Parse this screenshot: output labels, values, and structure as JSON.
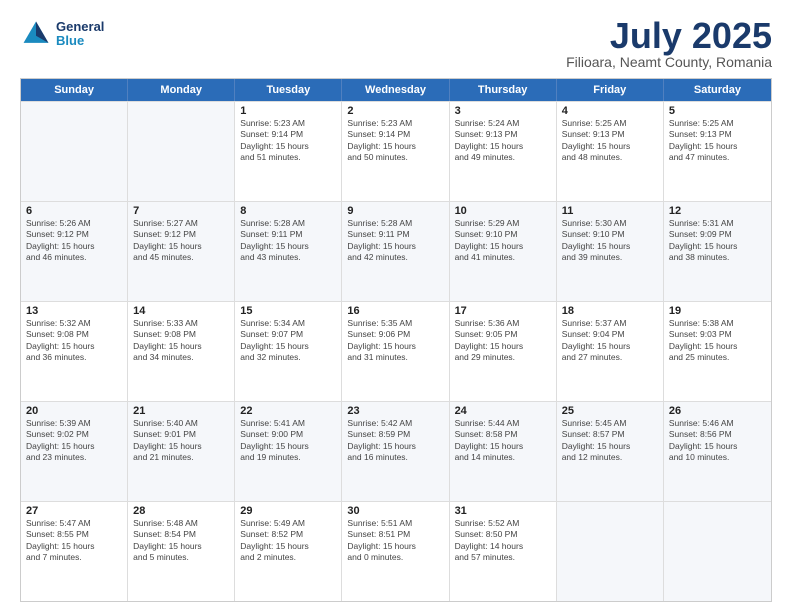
{
  "header": {
    "logo_line1": "General",
    "logo_line2": "Blue",
    "title": "July 2025",
    "subtitle": "Filioara, Neamt County, Romania"
  },
  "days_of_week": [
    "Sunday",
    "Monday",
    "Tuesday",
    "Wednesday",
    "Thursday",
    "Friday",
    "Saturday"
  ],
  "weeks": [
    [
      {
        "day": "",
        "info": ""
      },
      {
        "day": "",
        "info": ""
      },
      {
        "day": "1",
        "info": "Sunrise: 5:23 AM\nSunset: 9:14 PM\nDaylight: 15 hours\nand 51 minutes."
      },
      {
        "day": "2",
        "info": "Sunrise: 5:23 AM\nSunset: 9:14 PM\nDaylight: 15 hours\nand 50 minutes."
      },
      {
        "day": "3",
        "info": "Sunrise: 5:24 AM\nSunset: 9:13 PM\nDaylight: 15 hours\nand 49 minutes."
      },
      {
        "day": "4",
        "info": "Sunrise: 5:25 AM\nSunset: 9:13 PM\nDaylight: 15 hours\nand 48 minutes."
      },
      {
        "day": "5",
        "info": "Sunrise: 5:25 AM\nSunset: 9:13 PM\nDaylight: 15 hours\nand 47 minutes."
      }
    ],
    [
      {
        "day": "6",
        "info": "Sunrise: 5:26 AM\nSunset: 9:12 PM\nDaylight: 15 hours\nand 46 minutes."
      },
      {
        "day": "7",
        "info": "Sunrise: 5:27 AM\nSunset: 9:12 PM\nDaylight: 15 hours\nand 45 minutes."
      },
      {
        "day": "8",
        "info": "Sunrise: 5:28 AM\nSunset: 9:11 PM\nDaylight: 15 hours\nand 43 minutes."
      },
      {
        "day": "9",
        "info": "Sunrise: 5:28 AM\nSunset: 9:11 PM\nDaylight: 15 hours\nand 42 minutes."
      },
      {
        "day": "10",
        "info": "Sunrise: 5:29 AM\nSunset: 9:10 PM\nDaylight: 15 hours\nand 41 minutes."
      },
      {
        "day": "11",
        "info": "Sunrise: 5:30 AM\nSunset: 9:10 PM\nDaylight: 15 hours\nand 39 minutes."
      },
      {
        "day": "12",
        "info": "Sunrise: 5:31 AM\nSunset: 9:09 PM\nDaylight: 15 hours\nand 38 minutes."
      }
    ],
    [
      {
        "day": "13",
        "info": "Sunrise: 5:32 AM\nSunset: 9:08 PM\nDaylight: 15 hours\nand 36 minutes."
      },
      {
        "day": "14",
        "info": "Sunrise: 5:33 AM\nSunset: 9:08 PM\nDaylight: 15 hours\nand 34 minutes."
      },
      {
        "day": "15",
        "info": "Sunrise: 5:34 AM\nSunset: 9:07 PM\nDaylight: 15 hours\nand 32 minutes."
      },
      {
        "day": "16",
        "info": "Sunrise: 5:35 AM\nSunset: 9:06 PM\nDaylight: 15 hours\nand 31 minutes."
      },
      {
        "day": "17",
        "info": "Sunrise: 5:36 AM\nSunset: 9:05 PM\nDaylight: 15 hours\nand 29 minutes."
      },
      {
        "day": "18",
        "info": "Sunrise: 5:37 AM\nSunset: 9:04 PM\nDaylight: 15 hours\nand 27 minutes."
      },
      {
        "day": "19",
        "info": "Sunrise: 5:38 AM\nSunset: 9:03 PM\nDaylight: 15 hours\nand 25 minutes."
      }
    ],
    [
      {
        "day": "20",
        "info": "Sunrise: 5:39 AM\nSunset: 9:02 PM\nDaylight: 15 hours\nand 23 minutes."
      },
      {
        "day": "21",
        "info": "Sunrise: 5:40 AM\nSunset: 9:01 PM\nDaylight: 15 hours\nand 21 minutes."
      },
      {
        "day": "22",
        "info": "Sunrise: 5:41 AM\nSunset: 9:00 PM\nDaylight: 15 hours\nand 19 minutes."
      },
      {
        "day": "23",
        "info": "Sunrise: 5:42 AM\nSunset: 8:59 PM\nDaylight: 15 hours\nand 16 minutes."
      },
      {
        "day": "24",
        "info": "Sunrise: 5:44 AM\nSunset: 8:58 PM\nDaylight: 15 hours\nand 14 minutes."
      },
      {
        "day": "25",
        "info": "Sunrise: 5:45 AM\nSunset: 8:57 PM\nDaylight: 15 hours\nand 12 minutes."
      },
      {
        "day": "26",
        "info": "Sunrise: 5:46 AM\nSunset: 8:56 PM\nDaylight: 15 hours\nand 10 minutes."
      }
    ],
    [
      {
        "day": "27",
        "info": "Sunrise: 5:47 AM\nSunset: 8:55 PM\nDaylight: 15 hours\nand 7 minutes."
      },
      {
        "day": "28",
        "info": "Sunrise: 5:48 AM\nSunset: 8:54 PM\nDaylight: 15 hours\nand 5 minutes."
      },
      {
        "day": "29",
        "info": "Sunrise: 5:49 AM\nSunset: 8:52 PM\nDaylight: 15 hours\nand 2 minutes."
      },
      {
        "day": "30",
        "info": "Sunrise: 5:51 AM\nSunset: 8:51 PM\nDaylight: 15 hours\nand 0 minutes."
      },
      {
        "day": "31",
        "info": "Sunrise: 5:52 AM\nSunset: 8:50 PM\nDaylight: 14 hours\nand 57 minutes."
      },
      {
        "day": "",
        "info": ""
      },
      {
        "day": "",
        "info": ""
      }
    ]
  ]
}
